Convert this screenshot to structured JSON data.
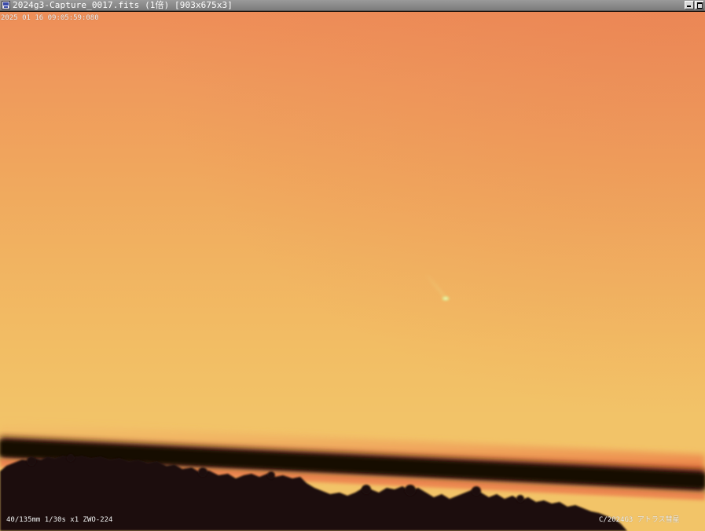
{
  "window": {
    "title": "2024g3-Capture_0017.fits (1倍) [903x675x3]"
  },
  "overlay": {
    "timestamp": "2025 01 16 09:05:59:080",
    "capture_info": "40/135mm   1/30s x1  ZWO-224",
    "object_name": "C/2024G3   アトラス彗星"
  },
  "icons": {
    "app": "fits-viewer-icon",
    "minimize": "minimize-icon",
    "maximize": "maximize-icon"
  },
  "colors": {
    "titlebar": "#8c8c8c",
    "sky_top": "#ee8e58",
    "sky_bottom": "#f2c468",
    "silhouette": "#1c0f0d",
    "bar_glow": "#ee7040",
    "comet": "#e8f090"
  }
}
